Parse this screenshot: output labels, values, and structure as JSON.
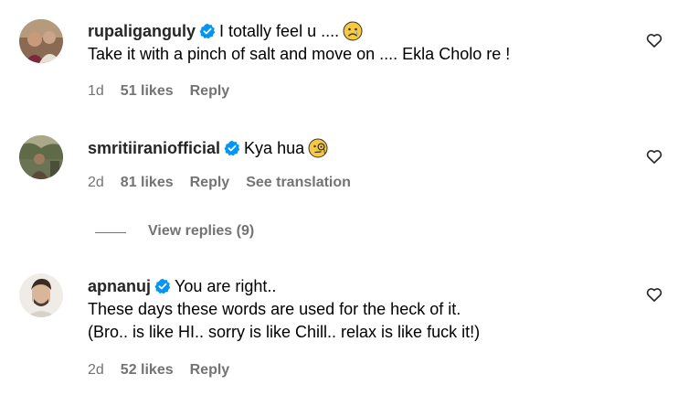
{
  "comments": [
    {
      "username": "rupaliganguly",
      "verified": true,
      "text_lines": [
        "I totally feel u ....",
        "Take it with a pinch of salt and move on .... Ekla Cholo re !"
      ],
      "emoji": "sad-face-emoji",
      "age": "1d",
      "likes": "51 likes",
      "reply_label": "Reply"
    },
    {
      "username": "smritiiraniofficial",
      "verified": true,
      "text_lines": [
        "Kya hua"
      ],
      "emoji": "face-with-monocle-emoji",
      "age": "2d",
      "likes": "81 likes",
      "reply_label": "Reply",
      "translation_label": "See translation",
      "view_replies": "View replies (9)"
    },
    {
      "username": "apnanuj",
      "verified": true,
      "text_lines": [
        "You are right..",
        "These days these words are used for the heck of it.",
        "(Bro.. is like HI.. sorry is like Chill.. relax is like fuck it!)"
      ],
      "age": "2d",
      "likes": "52 likes",
      "reply_label": "Reply"
    }
  ],
  "colors": {
    "text": "#000000",
    "username": "#262626",
    "secondary": "#737373",
    "verified_badge": "#0095f6"
  },
  "icons": {
    "like": "heart-outline-icon",
    "verified": "verified-badge-icon"
  }
}
